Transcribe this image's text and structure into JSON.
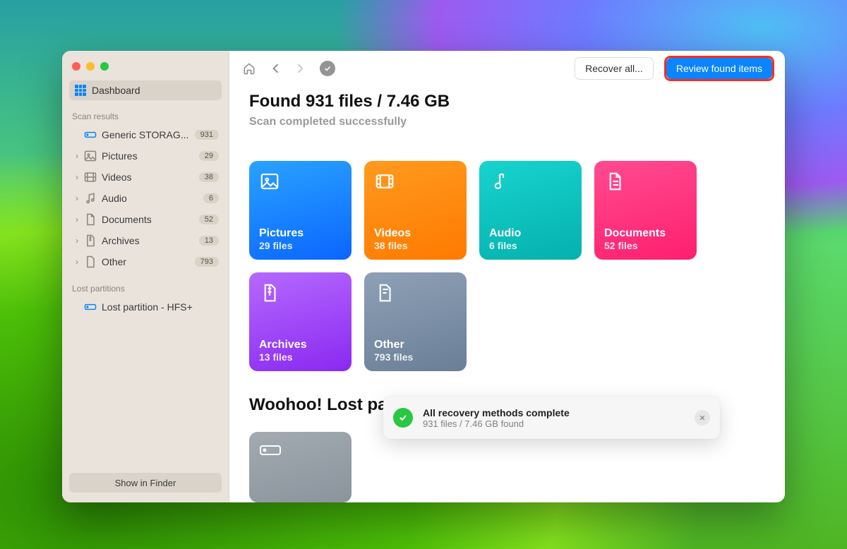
{
  "sidebar": {
    "dashboard_label": "Dashboard",
    "section_results": "Scan results",
    "section_lost": "Lost partitions",
    "storage": {
      "label": "Generic STORAG...",
      "badge": "931"
    },
    "items": [
      {
        "label": "Pictures",
        "badge": "29"
      },
      {
        "label": "Videos",
        "badge": "38"
      },
      {
        "label": "Audio",
        "badge": "6"
      },
      {
        "label": "Documents",
        "badge": "52"
      },
      {
        "label": "Archives",
        "badge": "13"
      },
      {
        "label": "Other",
        "badge": "793"
      }
    ],
    "lost_item": "Lost partition - HFS+",
    "finder_btn": "Show in Finder"
  },
  "toolbar": {
    "recover_label": "Recover all...",
    "review_label": "Review found items"
  },
  "heading": {
    "title": "Found 931 files / 7.46 GB",
    "subtitle": "Scan completed successfully"
  },
  "cards": {
    "pictures": {
      "title": "Pictures",
      "sub": "29 files"
    },
    "videos": {
      "title": "Videos",
      "sub": "38 files"
    },
    "audio": {
      "title": "Audio",
      "sub": "6 files"
    },
    "documents": {
      "title": "Documents",
      "sub": "52 files"
    },
    "archives": {
      "title": "Archives",
      "sub": "13 files"
    },
    "other": {
      "title": "Other",
      "sub": "793 files"
    }
  },
  "woohoo": "Woohoo! Lost partitions found...",
  "toast": {
    "title": "All recovery methods complete",
    "sub": "931 files / 7.46 GB found"
  }
}
